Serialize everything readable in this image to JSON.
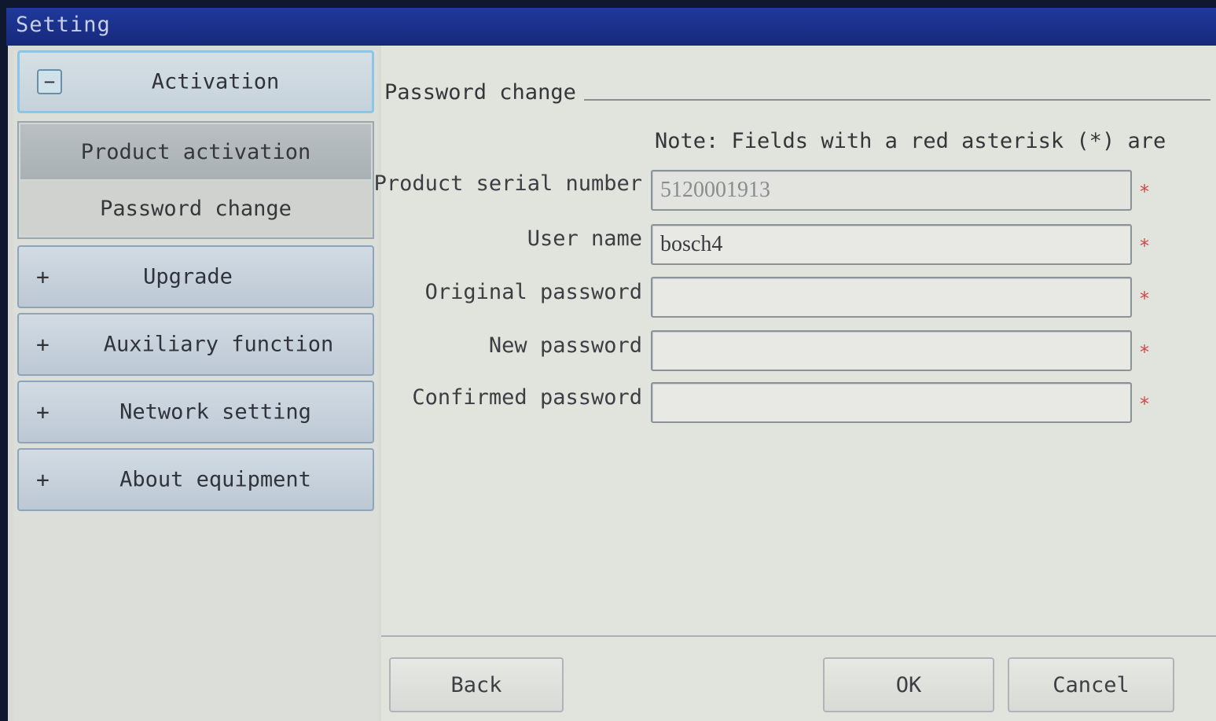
{
  "window": {
    "title": "Setting"
  },
  "nav": {
    "sections": [
      {
        "label": "Activation",
        "toggle": "−",
        "expanded": true
      },
      {
        "label": "Upgrade",
        "toggle": "+",
        "expanded": false
      },
      {
        "label": "Auxiliary function",
        "toggle": "+",
        "expanded": false
      },
      {
        "label": "Network setting",
        "toggle": "+",
        "expanded": false
      },
      {
        "label": "About equipment",
        "toggle": "+",
        "expanded": false
      }
    ],
    "activation_items": [
      {
        "label": "Product activation",
        "selected": true
      },
      {
        "label": "Password change",
        "selected": false
      }
    ]
  },
  "form": {
    "group_title": "Password change",
    "note": "Note: Fields with a red asterisk (*) are",
    "required_mark": "*",
    "required_color": "#d0484c",
    "fields": [
      {
        "label": "Product serial number",
        "value": "5120001913",
        "disabled": true
      },
      {
        "label": "User name",
        "value": "bosch4",
        "disabled": false
      },
      {
        "label": "Original password",
        "value": "",
        "disabled": false
      },
      {
        "label": "New password",
        "value": "",
        "disabled": false
      },
      {
        "label": "Confirmed password",
        "value": "",
        "disabled": false
      }
    ]
  },
  "buttons": {
    "back": "Back",
    "ok": "OK",
    "cancel": "Cancel"
  },
  "colors": {
    "titlebar": "#1a2f88",
    "expanded_border": "#8cc6e6"
  }
}
